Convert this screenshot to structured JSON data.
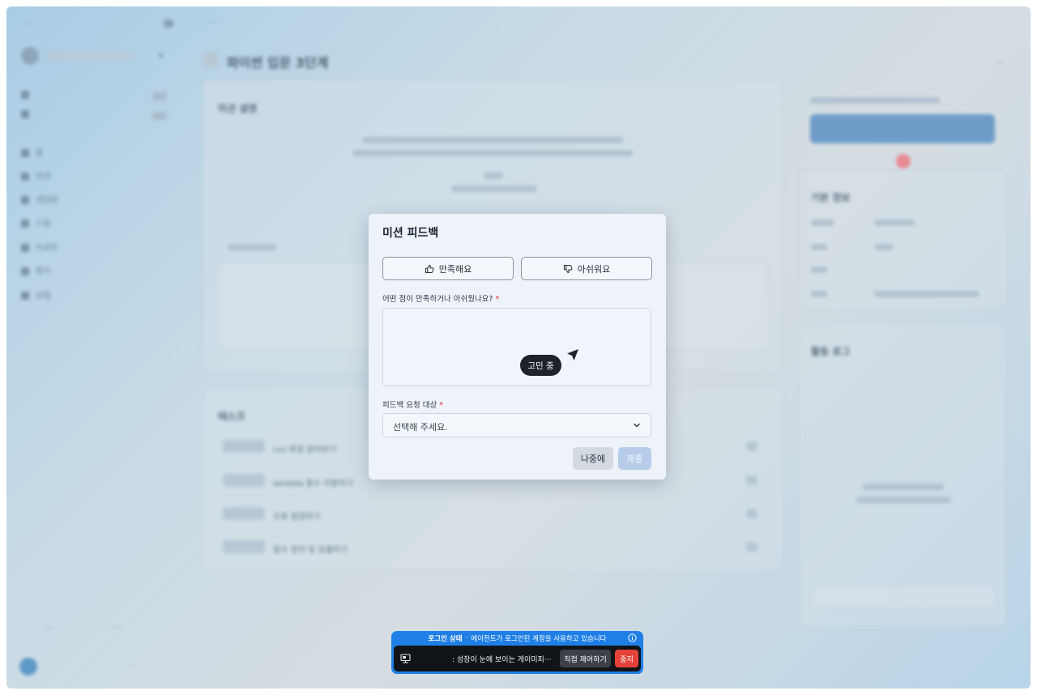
{
  "background": {
    "title": "파이썬 입문 3단계",
    "sidebar_items": [
      "홈",
      "미션",
      "게임판",
      "스킬",
      "리포트",
      "평가",
      "상점"
    ],
    "tasks": [
      "cvs 파일 읽어보기",
      "lambda 함수 이용하기",
      "오류 점검하기",
      "함수 정의 및 호출하기"
    ],
    "section_mission_desc": "미션 설명",
    "section_tasks": "태스크",
    "section_basic_info": "기본 정보",
    "section_activity_log": "활동 로그"
  },
  "dialog": {
    "title": "미션 피드백",
    "satisfied_label": "만족해요",
    "disappointed_label": "아쉬워요",
    "question_label": "어떤 점이 만족하거나 아쉬웠나요?",
    "question_required": "*",
    "target_label": "피드백 요청 대상",
    "target_required": "*",
    "target_placeholder": "선택해 주세요.",
    "later_label": "나중에",
    "submit_label": "제출",
    "thinking_label": "고민 중"
  },
  "agent_bar": {
    "status_title": "로그인 상태",
    "status_separator": "·",
    "status_message": "에이전트가 로그인된 계정을 사용하고 있습니다",
    "activity_text": ": 성장이 눈에 보이는 게이미피···",
    "takeover_label": "직접 제어하기",
    "stop_label": "중지"
  },
  "colors": {
    "agent_blue": "#1f7fe6",
    "stop_red": "#e5413a",
    "submit_disabled": "#b6ccea"
  }
}
